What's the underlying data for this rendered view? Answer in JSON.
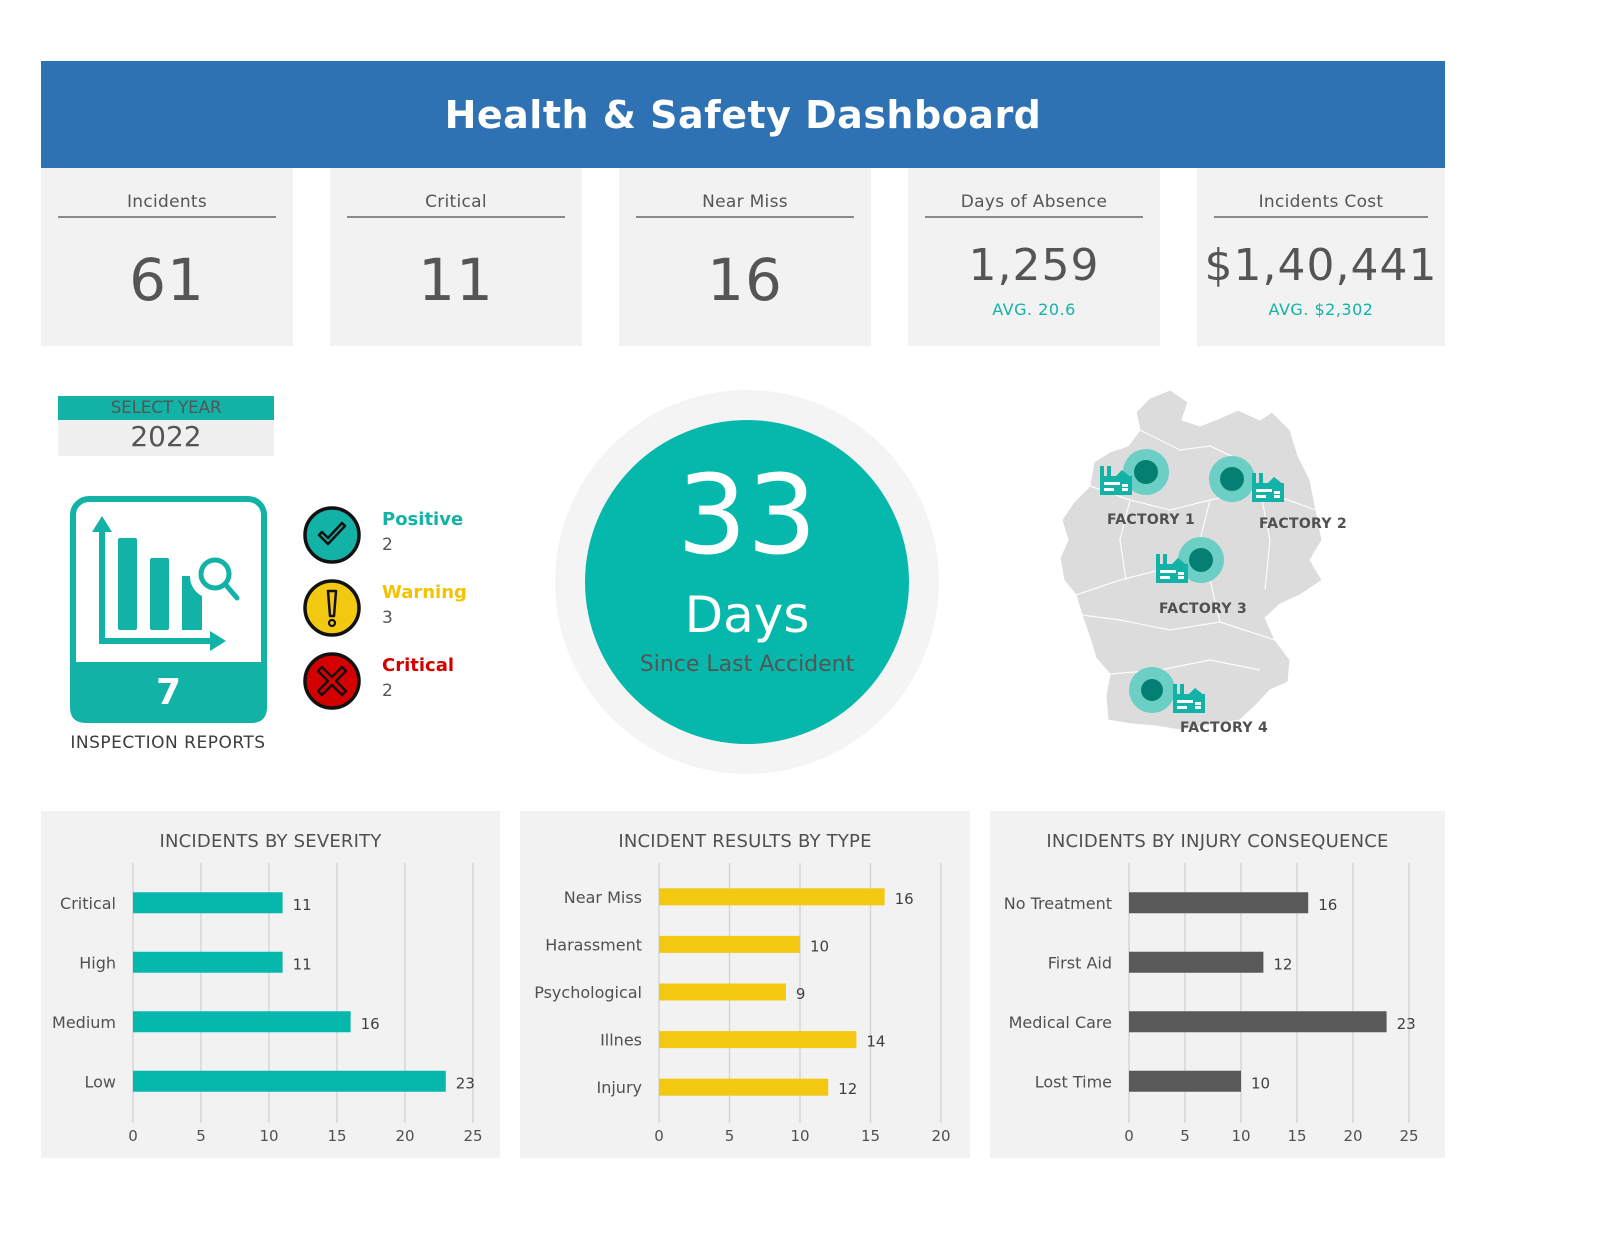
{
  "header": {
    "title": "Health & Safety Dashboard"
  },
  "kpis": [
    {
      "label": "Incidents",
      "value": "61"
    },
    {
      "label": "Critical",
      "value": "11"
    },
    {
      "label": "Near Miss",
      "value": "16"
    },
    {
      "label": "Days of Absence",
      "value": "1,259",
      "avg": "AVG. 20.6"
    },
    {
      "label": "Incidents Cost",
      "value": "$1,40,441",
      "avg": "AVG. $2,302"
    }
  ],
  "year_selector": {
    "label": "SELECT YEAR",
    "value": "2022"
  },
  "inspection": {
    "count": "7",
    "label": "INSPECTION REPORTS",
    "icon": "chart-magnifier-icon",
    "statuses": [
      {
        "name": "Positive",
        "count": "2",
        "color": "#12b3a6",
        "icon": "check-circle-icon"
      },
      {
        "name": "Warning",
        "count": "3",
        "color": "#f2c400",
        "icon": "exclamation-circle-icon"
      },
      {
        "name": "Critical",
        "count": "2",
        "color": "#d40000",
        "icon": "x-circle-icon"
      }
    ]
  },
  "days_since": {
    "number": "33",
    "unit": "Days",
    "caption": "Since Last Accident"
  },
  "map": {
    "region": "Germany",
    "factories": [
      {
        "label": "FACTORY 1"
      },
      {
        "label": "FACTORY 2"
      },
      {
        "label": "FACTORY 3"
      },
      {
        "label": "FACTORY 4"
      }
    ]
  },
  "colors": {
    "header": "#2e72b3",
    "teal": "#05b8ab",
    "yellow": "#f2c811",
    "dark_gray": "#595959",
    "card_bg": "#f2f2f2"
  },
  "chart_data": [
    {
      "type": "bar",
      "orientation": "horizontal",
      "title": "INCIDENTS BY SEVERITY",
      "categories": [
        "Critical",
        "High",
        "Medium",
        "Low"
      ],
      "values": [
        11,
        11,
        16,
        23
      ],
      "xlim": [
        0,
        25
      ],
      "xticks": [
        0,
        5,
        10,
        15,
        20,
        25
      ],
      "color": "#05b8ab",
      "grid": true
    },
    {
      "type": "bar",
      "orientation": "horizontal",
      "title": "INCIDENT RESULTS BY TYPE",
      "categories": [
        "Near Miss",
        "Harassment",
        "Psychological",
        "Illnes",
        "Injury"
      ],
      "values": [
        16,
        10,
        9,
        14,
        12
      ],
      "xlim": [
        0,
        20
      ],
      "xticks": [
        0,
        5,
        10,
        15,
        20
      ],
      "color": "#f2c811",
      "grid": true
    },
    {
      "type": "bar",
      "orientation": "horizontal",
      "title": "INCIDENTS BY INJURY CONSEQUENCE",
      "categories": [
        "No Treatment",
        "First Aid",
        "Medical Care",
        "Lost Time"
      ],
      "values": [
        16,
        12,
        23,
        10
      ],
      "xlim": [
        0,
        25
      ],
      "xticks": [
        0,
        5,
        10,
        15,
        20,
        25
      ],
      "color": "#595959",
      "grid": true
    }
  ]
}
